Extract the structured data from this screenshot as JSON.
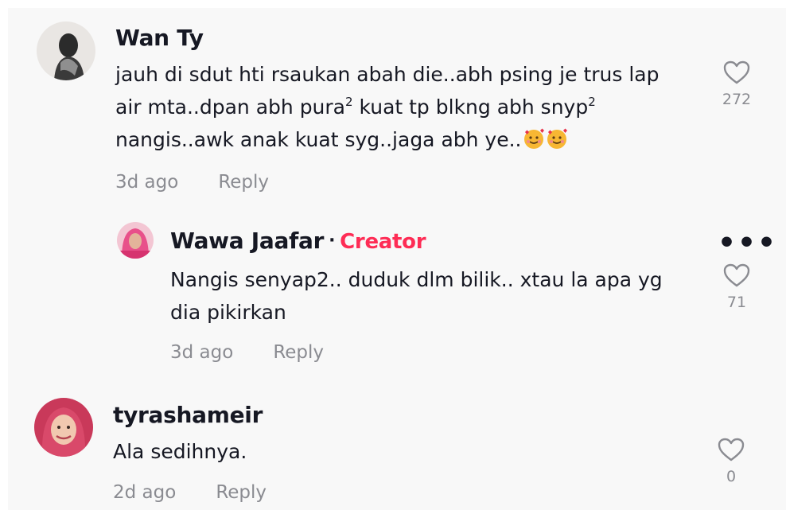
{
  "comments": [
    {
      "username": "Wan Ty",
      "text_line1": "jauh di sdut hti rsaukan abah die..abh psing je trus lap",
      "text_line2a": "air mta..dpan abh pura",
      "sup1": "2",
      "text_line2b": " kuat tp blkng abh snyp",
      "sup2": "2",
      "text_line3": "nangis..awk anak kuat syg..jaga abh ye..",
      "emoji": "smiling-face-with-hearts",
      "time": "3d ago",
      "reply_label": "Reply",
      "likes": "272"
    },
    {
      "username": "Wawa Jaafar",
      "separator": "·",
      "badge": "Creator",
      "text_line1": "Nangis senyap2.. duduk dlm bilik.. xtau la apa yg",
      "text_line2": "dia pikirkan",
      "time": "3d ago",
      "reply_label": "Reply",
      "likes": "71",
      "more_label": "•••"
    },
    {
      "username": "tyrashameir",
      "text_line1": "Ala sedihnya.",
      "time": "2d ago",
      "reply_label": "Reply",
      "likes": "0"
    }
  ],
  "colors": {
    "creator": "#fe2c55",
    "meta": "#8a8b91",
    "text": "#161823",
    "background": "#f8f8f8"
  }
}
